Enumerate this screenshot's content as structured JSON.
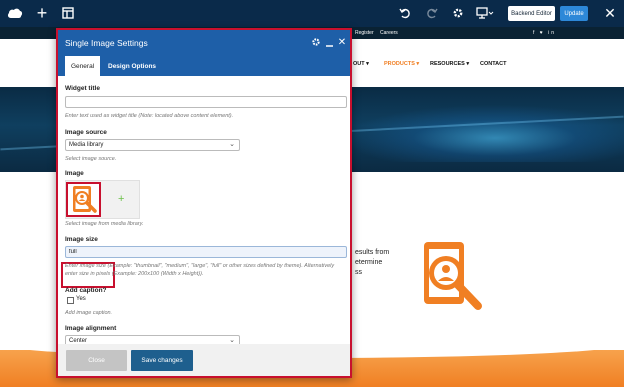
{
  "toolbar": {
    "logo_icon": "cloud-logo-icon",
    "add_icon": "plus-icon",
    "layout_icon": "layout-icon",
    "undo_icon": "undo-icon",
    "redo_icon": "redo-icon",
    "settings_icon": "gear-icon",
    "screen_icon": "monitor-icon",
    "close_icon": "close-icon",
    "backend_editor_label": "Backend Editor",
    "update_label": "Update"
  },
  "site": {
    "top_links": [
      "Register",
      "Careers"
    ],
    "social": "f ♥ in",
    "nav": [
      {
        "label": "OUT",
        "active": false
      },
      {
        "label": "PRODUCTS",
        "active": true
      },
      {
        "label": "RESOURCES",
        "active": false
      },
      {
        "label": "CONTACT",
        "active": false
      }
    ],
    "bg_text_lines": [
      "esults from",
      "etermine",
      "ss"
    ]
  },
  "modal": {
    "title": "Single Image Settings",
    "tabs": [
      "General",
      "Design Options"
    ],
    "fields": {
      "widget_title": {
        "label": "Widget title",
        "value": "",
        "help": "Enter text used as widget title (Note: located above content element)."
      },
      "image_source": {
        "label": "Image source",
        "value": "Media library",
        "help": "Select image source."
      },
      "image": {
        "label": "Image",
        "help": "Select image from media library."
      },
      "image_size": {
        "label": "Image size",
        "value": "full",
        "help": "Enter image size (Example: \"thumbnail\", \"medium\", \"large\", \"full\" or other sizes defined by theme). Alternatively enter size in pixels (Example: 200x100 (Width x Height))."
      },
      "add_caption": {
        "label": "Add caption?",
        "option": "Yes",
        "checked": false,
        "help": "Add image caption."
      },
      "image_alignment": {
        "label": "Image alignment",
        "value": "Center"
      }
    },
    "footer": {
      "close_label": "Close",
      "save_label": "Save changes"
    }
  },
  "colors": {
    "toolbar_bg": "#0a2a4a",
    "modal_header": "#1e5fa8",
    "highlight": "#c8102e",
    "accent_orange": "#f07f23",
    "save_button": "#1e5f8e"
  }
}
